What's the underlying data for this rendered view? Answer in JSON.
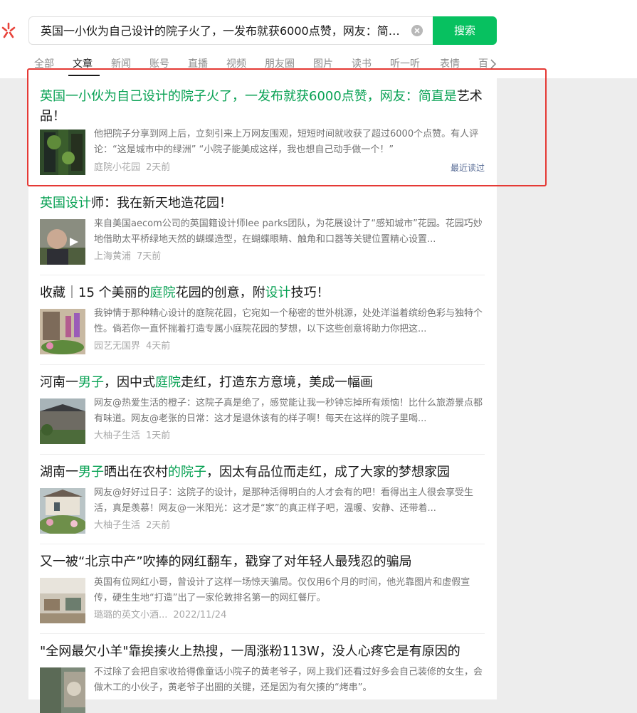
{
  "search": {
    "query": "英国一小伙为自己设计的院子火了，一发布就获6000点赞，网友：简直是艺术品！",
    "button_label": "搜索"
  },
  "tabs": [
    "全部",
    "文章",
    "新闻",
    "账号",
    "直播",
    "视频",
    "朋友圈",
    "图片",
    "读书",
    "听一听",
    "表情",
    "百"
  ],
  "active_tab": "文章",
  "colors": {
    "accent": "#07c160",
    "highlight_text": "#07a153",
    "annotation_box": "#e53935",
    "link": "#576b95"
  },
  "results": [
    {
      "title": "英国一小伙为自己设计的院子火了，一发布就获6000点赞，网友：简直是艺术品！",
      "summary": "他把院子分享到网上后，立刻引来上万网友围观，短短时间就收获了超过6000个点赞。有人评论：“这是城市中的绿洲” “小院子能美成这样，我也想自己动手做一个！”",
      "source": "庭院小花园",
      "date": "2天前",
      "badge": "最近读过"
    },
    {
      "title": "英国设计师：我在新天地造花园！",
      "summary": "来自美国aecom公司的英国籍设计师lee parks团队，为花展设计了“感知城市”花园。花园巧妙地借助太平桥绿地天然的蝴蝶造型，在蝴蝶眼睛、触角和口器等关键位置精心设置...",
      "source": "上海黄浦",
      "date": "7天前"
    },
    {
      "title": "收藏｜15 个美丽的庭院花园的创意，附设计技巧！",
      "summary": "我钟情于那种精心设计的庭院花园，它宛如一个秘密的世外桃源，处处洋溢着缤纷色彩与独特个性。倘若你一直怀揣着打造专属小庭院花园的梦想，以下这些创意将助力你把这...",
      "source": "园艺无国界",
      "date": "4天前"
    },
    {
      "title": "河南一男子，因中式庭院走红，打造东方意境，美成一幅画",
      "summary": "网友@热爱生活的橙子：这院子真是绝了，感觉能让我一秒钟忘掉所有烦恼！比什么旅游景点都有味道。网友@老张的日常：这才是退休该有的样子啊！每天在这样的院子里喝...",
      "source": "大柚子生活",
      "date": "1天前"
    },
    {
      "title": "湖南一男子晒出在农村的院子，因太有品位而走红，成了大家的梦想家园",
      "summary": "网友@好好过日子：这院子的设计，是那种活得明白的人才会有的吧！看得出主人很会享受生活，真是羡慕！网友@一米阳光：这才是“家”的真正样子吧，温暖、安静、还带着...",
      "source": "大柚子生活",
      "date": "2天前"
    },
    {
      "title": "又一被“北京中产”吹捧的网红翻车，戳穿了对年轻人最残忍的骗局",
      "summary": "英国有位网红小哥，曾设计了这样一场惊天骗局。仅仅用6个月的时间，他光靠图片和虚假宣传，硬生生地“打造”出了一家伦敦排名第一的网红餐厅。",
      "source": "璐璐的英文小酒...",
      "date": "2022/11/24"
    },
    {
      "title": "\"全网最欠小羊\"靠挨揍火上热搜，一周涨粉113W，没人心疼它是有原因的",
      "summary": "不过除了会把自家收拾得像童话小院子的黄老爷子，网上我们还看过好多会自己装修的女生，会做木工的小伙子，黄老爷子出圈的关键，还是因为有欠揍的“烤串”。",
      "source": "",
      "date": ""
    }
  ]
}
